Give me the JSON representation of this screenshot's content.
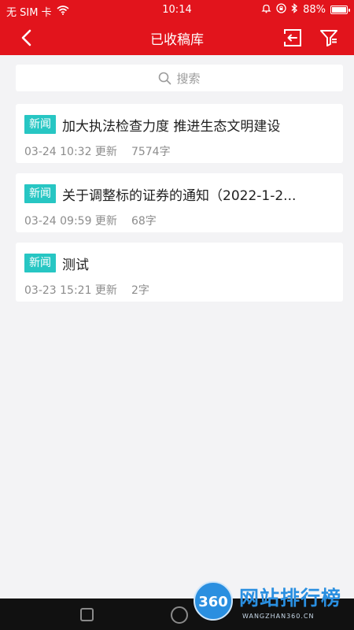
{
  "status_bar": {
    "carrier": "无 SIM 卡",
    "time": "10:14",
    "battery": "88%",
    "battery_level": 0.88
  },
  "nav": {
    "title": "已收稿库",
    "back_icon": "chevron-left-icon",
    "import_icon": "import-icon",
    "filter_icon": "filter-icon"
  },
  "search": {
    "placeholder": "搜索",
    "icon": "search-icon"
  },
  "articles": [
    {
      "tag": "新闻",
      "title": "加大执法检查力度 推进生态文明建设",
      "time": "03-24 10:32 更新",
      "count": "7574字"
    },
    {
      "tag": "新闻",
      "title": "关于调整标的证券的通知（2022-1-2...",
      "time": "03-24 09:59 更新",
      "count": "68字"
    },
    {
      "tag": "新闻",
      "title": "测试",
      "time": "03-23 15:21 更新",
      "count": "2字"
    }
  ],
  "watermark": {
    "badge": "360",
    "name": "网站排行榜",
    "domain": "WANGZHAN360.CN"
  },
  "colors": {
    "brand": "#e2141c",
    "tag": "#27c6c3",
    "background": "#f3f3f5"
  }
}
